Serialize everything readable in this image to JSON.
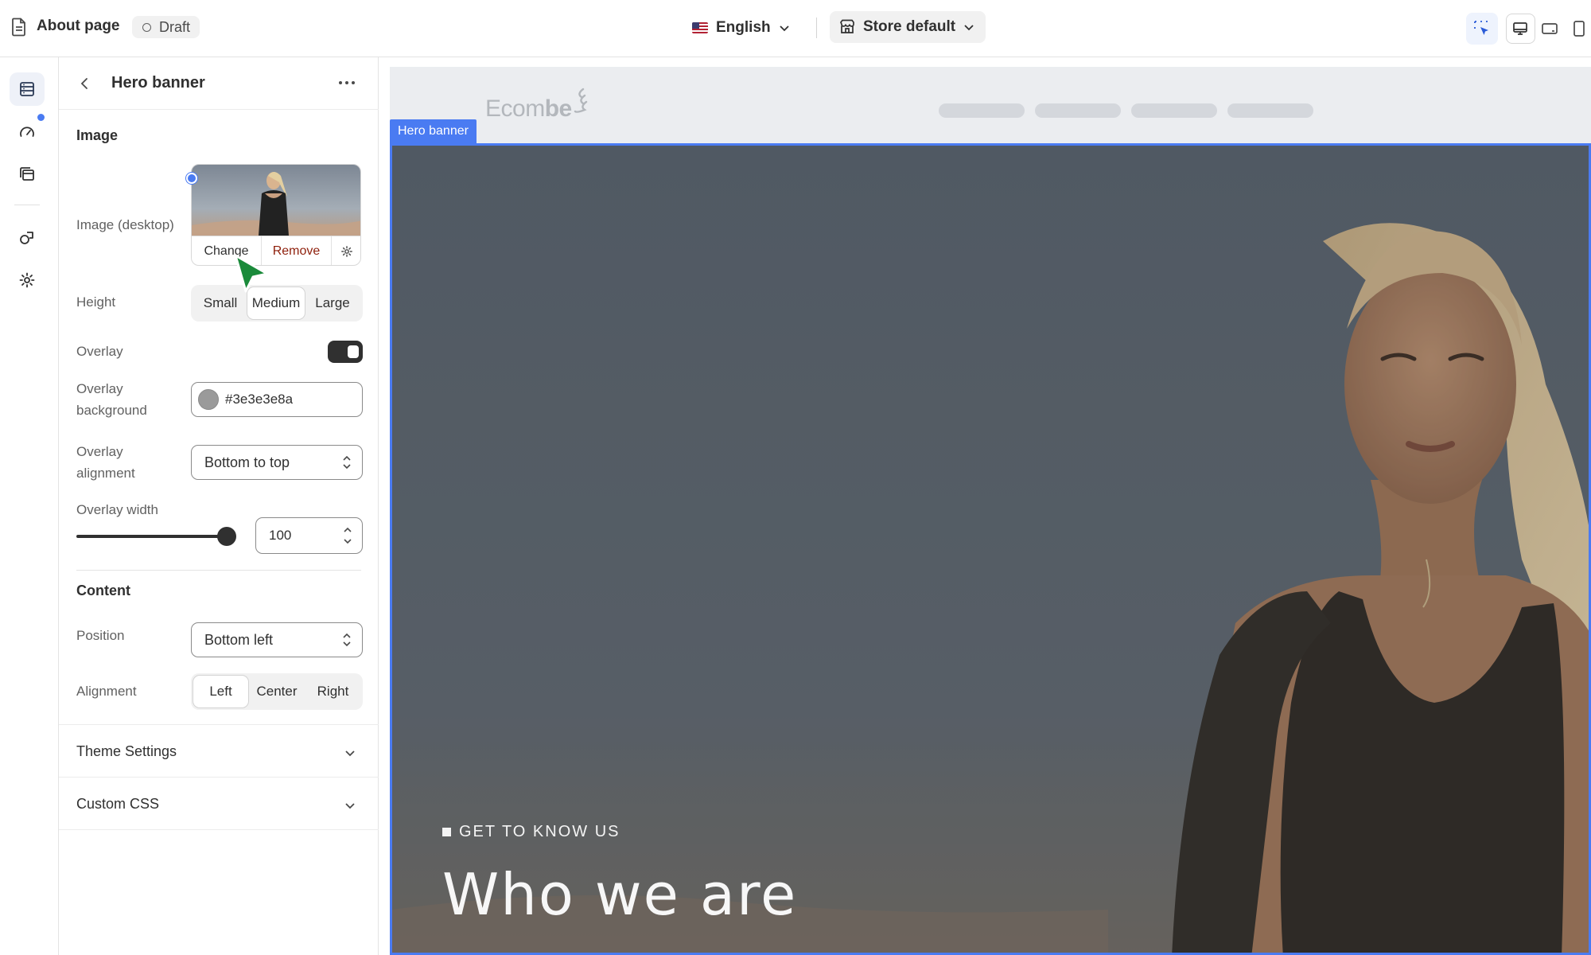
{
  "topbar": {
    "page_title": "About page",
    "status": "Draft",
    "language": "English",
    "store": "Store default"
  },
  "rail": {
    "items": [
      "sections",
      "speed",
      "templates",
      "apps",
      "settings"
    ]
  },
  "panel": {
    "title": "Hero banner",
    "image_section": "Image",
    "image_desktop_label": "Image (desktop)",
    "change_label": "Change",
    "remove_label": "Remove",
    "height_label": "Height",
    "height_options": [
      "Small",
      "Medium",
      "Large"
    ],
    "height_selected": "Medium",
    "overlay_label": "Overlay",
    "overlay_enabled": true,
    "overlay_bg_label_1": "Overlay",
    "overlay_bg_label_2": "background",
    "overlay_bg_value": "#3e3e3e8a",
    "overlay_align_label_1": "Overlay",
    "overlay_align_label_2": "alignment",
    "overlay_align_value": "Bottom to top",
    "overlay_width_label": "Overlay width",
    "overlay_width_value": "100",
    "content_section": "Content",
    "position_label": "Position",
    "position_value": "Bottom left",
    "alignment_label": "Alignment",
    "alignment_options": [
      "Left",
      "Center",
      "Right"
    ],
    "alignment_selected": "Left",
    "theme_settings": "Theme Settings",
    "custom_css": "Custom CSS"
  },
  "preview": {
    "logo_light": "Ecom",
    "logo_bold": "be",
    "section_tag": "Hero banner",
    "eyebrow": "GET TO KNOW US",
    "heading": "Who we are"
  },
  "colors": {
    "accent": "#4a7bf2",
    "remove": "#8e1f0b",
    "cursor": "#1a8a3a"
  }
}
